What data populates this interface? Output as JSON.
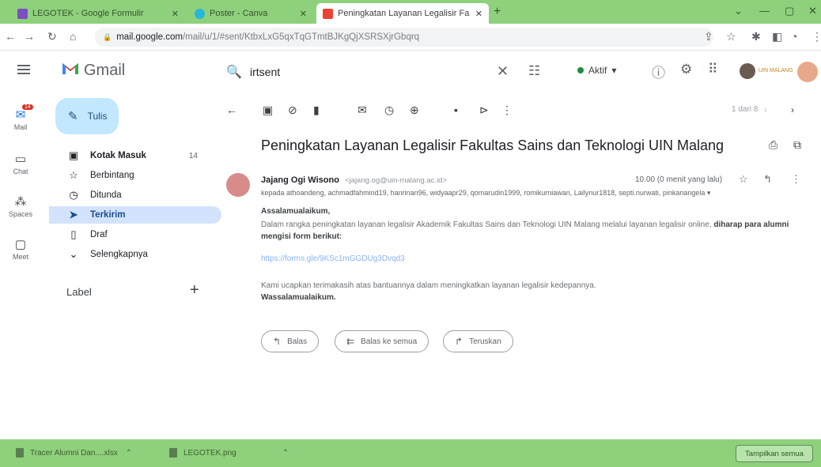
{
  "browser": {
    "tabs": [
      {
        "label": "LEGOTEK - Google Formulir",
        "color": "#7b4fbf"
      },
      {
        "label": "Poster - Canva",
        "color": "#29b6d8"
      },
      {
        "label": "Peningkatan Layanan Legalisir Fa",
        "color": "#ea4335"
      }
    ],
    "url_host": "mail.google.com",
    "url_path": "/mail/u/1/#sent/KtbxLxG5qxTqGTmtBJKgQjXSRSXjrGbqrq"
  },
  "gmail": {
    "app_name": "Gmail",
    "search_value": "irtsent",
    "status": "Aktif",
    "org_logo_text": "UIN MALANG"
  },
  "rail": [
    {
      "label": "Mail",
      "badge": "14"
    },
    {
      "label": "Chat"
    },
    {
      "label": "Spaces"
    },
    {
      "label": "Meet"
    }
  ],
  "compose_label": "Tulis",
  "nav": [
    {
      "label": "Kotak Masuk",
      "count": "14"
    },
    {
      "label": "Berbintang"
    },
    {
      "label": "Ditunda"
    },
    {
      "label": "Terkirim"
    },
    {
      "label": "Draf"
    },
    {
      "label": "Selengkapnya"
    }
  ],
  "labels_heading": "Label",
  "pager": "1 dari 8",
  "message": {
    "subject": "Peningkatan Layanan Legalisir Fakultas Sains dan Teknologi UIN Malang",
    "sender_name": "Jajang Ogi Wisono",
    "sender_email": "<jajang.og@uin-malang.ac.id>",
    "time": "10.00 (0 menit yang lalu)",
    "recipients": "kepada athoandeng, achmadfahmind19, hanrinan96, widyaapr29, qomarudin1999, romikurniawan, Lailynur1818, septi.nurwati, pinkanangela ▾",
    "greeting": "Assalamualaikum,",
    "paragraph": "Dalam rangka peningkatan layanan legalisir Akademik Fakultas Sains dan Teknologi UIN Malang melalui layanan legalisir online,",
    "paragraph_bold": "diharap para alumni mengisi form berikut:",
    "link": "https://forms.gle/9KSc1mGGDUg3Dvqd3",
    "thanks": "Kami ucapkan terimakasih atas bantuannya dalam meningkatkan layanan legalisir kedepannya.",
    "closing": "Wassalamualaikum."
  },
  "actions": {
    "reply": "Balas",
    "reply_all": "Balas ke semua",
    "forward": "Teruskan"
  },
  "downloads": {
    "items": [
      "Tracer Alumni Dan....xlsx",
      "LEGOTEK.png"
    ],
    "show_all": "Tampilkan semua"
  },
  "colors": {
    "chrome_frame": "#8fd07c",
    "compose_bg": "#c2e7ff",
    "active_nav": "#d3e3fd",
    "status_dot": "#1e8e3e"
  }
}
